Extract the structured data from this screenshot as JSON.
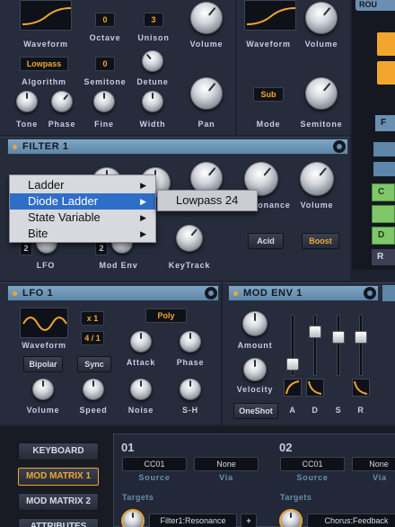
{
  "osc1": {
    "waveform": "Waveform",
    "octave_label": "Octave",
    "octave_value": "0",
    "unison_label": "Unison",
    "unison_value": "3",
    "volume": "Volume",
    "algorithm_label": "Algorithm",
    "algorithm_value": "Lowpass",
    "semitone_label": "Semitone",
    "semitone_value": "0",
    "detune": "Detune",
    "tone": "Tone",
    "phase": "Phase",
    "fine": "Fine",
    "width": "Width",
    "pan": "Pan"
  },
  "osc2": {
    "waveform": "Waveform",
    "volume": "Volume",
    "mode_label": "Mode",
    "mode_value": "Sub",
    "semitone": "Semitone"
  },
  "right": {
    "top_tab": "ROU",
    "f_tab": "F",
    "c_btn": "C",
    "d_btn": "D",
    "r_btn": "R"
  },
  "filter": {
    "title": "FILTER 1",
    "resonance": "Resonance",
    "volume": "Volume",
    "lfo_val": "2",
    "lfo": "LFO",
    "modenv_val": "2",
    "modenv": "Mod Env",
    "keytrack": "KeyTrack",
    "acid": "Acid",
    "boost": "Boost",
    "menu": [
      {
        "label": "Ladder"
      },
      {
        "label": "Diode Ladder"
      },
      {
        "label": "State Variable"
      },
      {
        "label": "Bite"
      }
    ],
    "submenu": "Lowpass 24"
  },
  "lfo": {
    "title": "LFO 1",
    "waveform": "Waveform",
    "mult": "x 1",
    "rate": "4 / 1",
    "poly": "Poly",
    "bipolar": "Bipolar",
    "sync": "Sync",
    "attack": "Attack",
    "phase": "Phase",
    "volume": "Volume",
    "speed": "Speed",
    "noise": "Noise",
    "sh": "S-H"
  },
  "modenv": {
    "title": "MOD ENV 1",
    "amount": "Amount",
    "velocity": "Velocity",
    "oneshot": "OneShot",
    "a": "A",
    "d": "D",
    "s": "S",
    "r": "R"
  },
  "nav": {
    "keyboard": "KEYBOARD",
    "modmatrix1": "MOD MATRIX 1",
    "modmatrix2": "MOD MATRIX 2",
    "attributes": "ATTRIBUTES"
  },
  "matrix": {
    "slot1": {
      "num": "01",
      "source_val": "CC01",
      "via_val": "None",
      "source": "Source",
      "via": "Via",
      "targets": "Targets",
      "target_val": "Filter1:Resonance",
      "plus": "+"
    },
    "slot2": {
      "num": "02",
      "source_val": "CC01",
      "via_val": "None",
      "source": "Source",
      "via": "Via",
      "targets": "Targets",
      "target_val": "Chorus:Feedback"
    }
  }
}
